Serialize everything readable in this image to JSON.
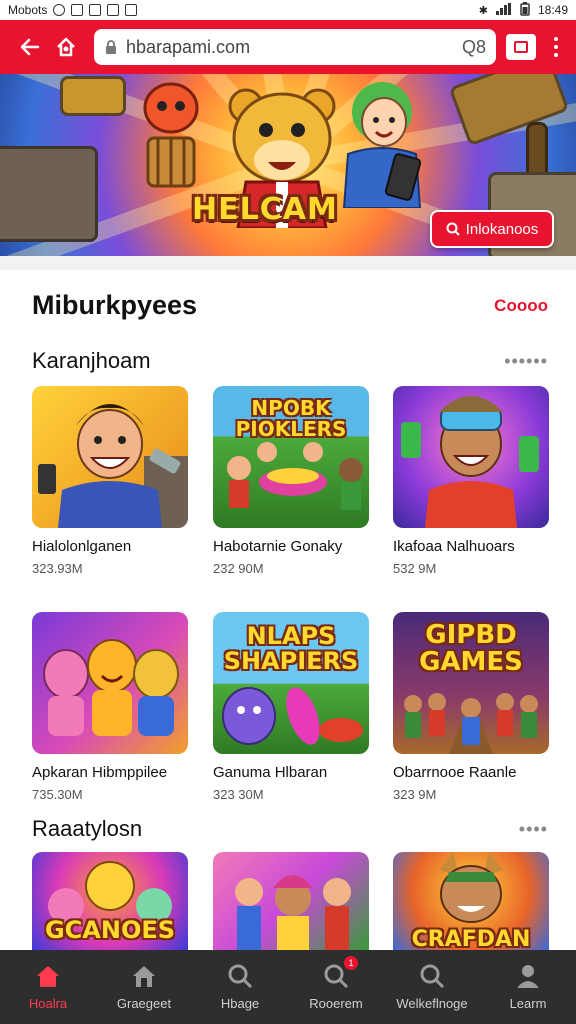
{
  "statusbar": {
    "carrier": "Mobots",
    "time": "18:49"
  },
  "browser": {
    "url": "hbarapami.com",
    "url_right": "Q8",
    "back_icon": "back-arrow-icon",
    "home_icon": "home-icon",
    "tabs_icon": "tabs-icon",
    "menu_icon": "kebab-menu-icon"
  },
  "banner": {
    "title": "HELCAM",
    "button_label": "Inlokanoos",
    "colors": {
      "accent": "#e8132e",
      "title": "#ffd92e"
    }
  },
  "main": {
    "title": "Miburkpyees",
    "title_more": "Coooo"
  },
  "sections": [
    {
      "title": "Karanjhoam",
      "more": "••••••",
      "items": [
        {
          "name": "Hialolonlganen",
          "size": "323.93M"
        },
        {
          "name": "Habotarnie Gonaky",
          "size": "232 90M"
        },
        {
          "name": "Ikafoaa Nalhuoars",
          "size": "532 9M"
        },
        {
          "name": "Apkaran Hibmppilee",
          "size": "735.30M",
          "thumb_text": ""
        },
        {
          "name": "Ganuma Hlbaran",
          "size": "323 30M",
          "thumb_text": "NLAPS SHAPIERS"
        },
        {
          "name": "Obarrnooe Raanle",
          "size": "323 9M",
          "thumb_text": "GIPBD GAMES"
        }
      ]
    },
    {
      "title": "Raaatylosn",
      "more": "••••",
      "items": [
        {
          "thumb_text": "GCANOES"
        },
        {
          "thumb_text": ""
        },
        {
          "thumb_text": "CRAFDAN"
        }
      ]
    }
  ],
  "thumb_texts": {
    "card2": "NPOBK PIOKLERS"
  },
  "bottom_nav": [
    {
      "label": "Hoalra",
      "icon": "home-icon",
      "active": true
    },
    {
      "label": "Graegeet",
      "icon": "shop-icon"
    },
    {
      "label": "Hbage",
      "icon": "search-icon"
    },
    {
      "label": "Rooerem",
      "icon": "search-badge-icon",
      "badge": "1"
    },
    {
      "label": "Welkeflnoge",
      "icon": "search-icon"
    },
    {
      "label": "Learm",
      "icon": "profile-icon"
    }
  ]
}
